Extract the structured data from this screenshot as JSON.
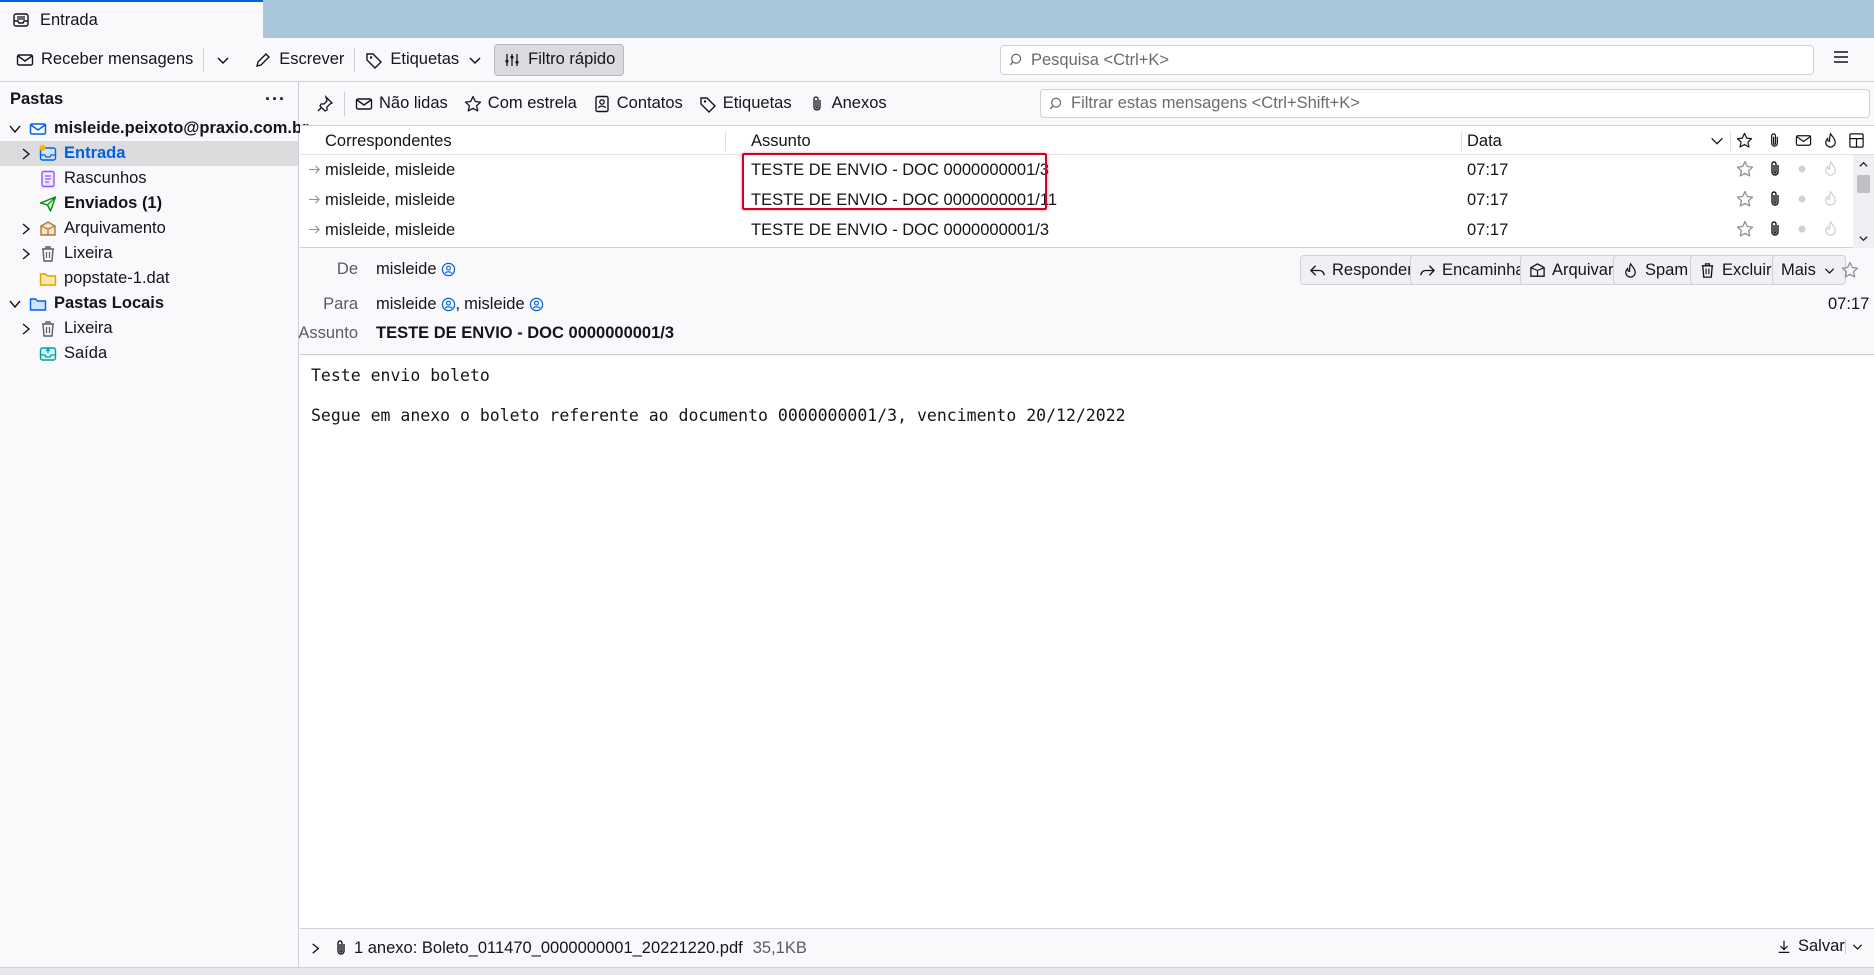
{
  "tab": {
    "title": "Entrada"
  },
  "toolbar": {
    "get_messages": "Receber mensagens",
    "write": "Escrever",
    "tags": "Etiquetas",
    "quick_filter": "Filtro rápido",
    "search_placeholder": "Pesquisa <Ctrl+K>"
  },
  "folder_pane": {
    "title": "Pastas",
    "folders": [
      {
        "label": "misleide.peixoto@praxio.com.br"
      },
      {
        "label": "Entrada"
      },
      {
        "label": "Rascunhos"
      },
      {
        "label": "Enviados (1)"
      },
      {
        "label": "Arquivamento"
      },
      {
        "label": "Lixeira"
      },
      {
        "label": "popstate-1.dat"
      },
      {
        "label": "Pastas Locais"
      },
      {
        "label": "Lixeira"
      },
      {
        "label": "Saída"
      }
    ]
  },
  "quick_filter": {
    "unread": "Não lidas",
    "starred": "Com estrela",
    "contacts": "Contatos",
    "tags": "Etiquetas",
    "attachments": "Anexos",
    "filter_placeholder": "Filtrar estas mensagens <Ctrl+Shift+K>"
  },
  "thread_pane": {
    "columns": {
      "correspondents": "Correspondentes",
      "subject": "Assunto",
      "date": "Data"
    },
    "rows": [
      {
        "correspondents": "misleide, misleide",
        "subject": "TESTE DE ENVIO - DOC 0000000001/3",
        "date": "07:17"
      },
      {
        "correspondents": "misleide, misleide",
        "subject": "TESTE DE ENVIO - DOC 0000000001/11",
        "date": "07:17"
      },
      {
        "correspondents": "misleide, misleide",
        "subject": "TESTE DE ENVIO - DOC 0000000001/3",
        "date": "07:17"
      }
    ]
  },
  "message_header": {
    "from_label": "De",
    "from": "misleide",
    "to_label": "Para",
    "to_1": "misleide",
    "to_2": "misleide",
    "to_sep": ",",
    "subject_label": "Assunto",
    "subject": "TESTE DE ENVIO - DOC 0000000001/3",
    "time": "07:17",
    "actions": {
      "reply": "Responder",
      "forward": "Encaminhar",
      "archive": "Arquivar",
      "junk": "Spam",
      "delete": "Excluir",
      "more": "Mais"
    }
  },
  "message_body": {
    "line1": "Teste envio boleto",
    "line2": "Segue em anexo o boleto referente ao documento 0000000001/3, vencimento 20/12/2022"
  },
  "attachments": {
    "summary": "1 anexo: Boleto_011470_0000000001_20221220.pdf",
    "size": "35,1KB",
    "save": "Salvar"
  },
  "colors": {
    "accent": "#0061e0",
    "highlight": "#d70022",
    "tabbar": "#a9c7d9"
  }
}
